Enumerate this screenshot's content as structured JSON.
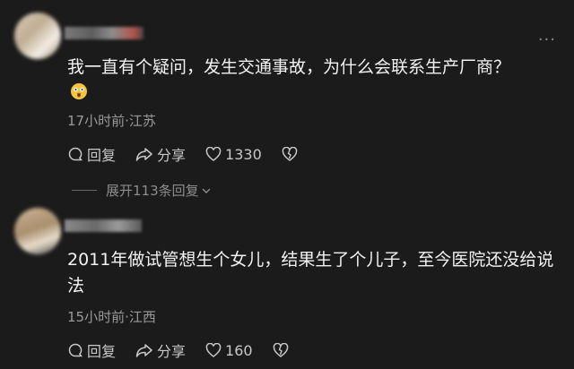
{
  "comments": [
    {
      "text": "我一直有个疑问，发生交通事故，为什么会联系生产厂商？",
      "meta": "17小时前·江苏",
      "actions": {
        "reply": "回复",
        "share": "分享",
        "likes": "1330"
      },
      "expand": "展开113条回复"
    },
    {
      "text": "2011年做试管想生个女儿，结果生了个儿子，至今医院还没给说法",
      "meta": "15小时前·江西",
      "actions": {
        "reply": "回复",
        "share": "分享",
        "likes": "160"
      }
    }
  ],
  "colors": {
    "background": "#1b1b1b",
    "text_primary": "#f2f2f2",
    "text_secondary": "#9a9a9a"
  }
}
